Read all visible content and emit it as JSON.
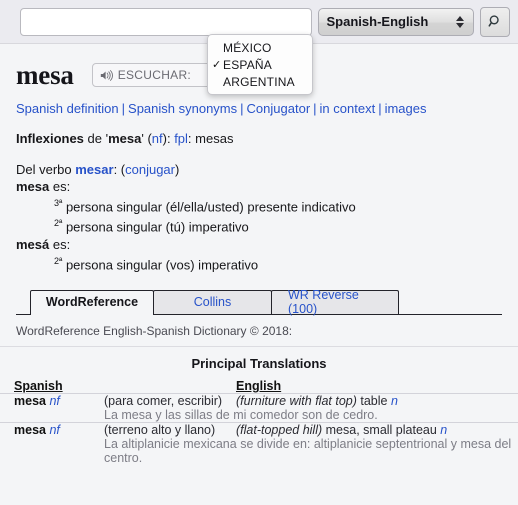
{
  "search": {
    "input_value": "",
    "input_placeholder": "",
    "dictionary_selected": "Spanish-English",
    "search_icon": "magnifier-icon"
  },
  "entry": {
    "headword": "mesa",
    "listen_label": "ESCUCHAR:",
    "speaker_icon": "speaker-icon"
  },
  "region_menu": {
    "items": [
      {
        "label": "MÉXICO",
        "checked": false,
        "check_glyph": ""
      },
      {
        "label": "ESPAÑA",
        "checked": true,
        "check_glyph": "✓"
      },
      {
        "label": "ARGENTINA",
        "checked": false,
        "check_glyph": ""
      }
    ]
  },
  "links": [
    "Spanish definition",
    "Spanish synonyms",
    "Conjugator",
    "in context",
    "images"
  ],
  "link_separator": "|",
  "inflections": {
    "label": "Inflexiones",
    "de": " de '",
    "word": "mesa",
    "close_quote": "' (",
    "gender": "nf",
    "colon": "): ",
    "plural_tag": "fpl",
    "plural_sep": ": ",
    "plural_form": "mesas"
  },
  "verb_block": {
    "intro": "Del verbo ",
    "verb": "mesar",
    "intro_tail": ": (",
    "conjugate_link": "conjugar",
    "intro_close": ")",
    "forms": [
      {
        "form": "mesa",
        "es": " es:",
        "senses": [
          "3ª persona singular (él/ella/usted) presente indicativo",
          "2ª persona singular (tú) imperativo"
        ]
      },
      {
        "form": "mesá",
        "es": " es:",
        "senses": [
          "2ª persona singular (vos) imperativo"
        ]
      }
    ]
  },
  "tabs": [
    {
      "label": "WordReference",
      "active": true
    },
    {
      "label": "Collins",
      "active": false
    },
    {
      "label": "WR Reverse (100)",
      "active": false
    }
  ],
  "dictionary": {
    "copyright": "WordReference English-Spanish Dictionary © 2018:",
    "section_title": "Principal Translations",
    "columns": {
      "spanish": "Spanish",
      "english": "English"
    },
    "rows": [
      {
        "headword": "mesa",
        "pos": "nf",
        "context_es": "(para comer, escribir)",
        "context_en": "(furniture with flat top)",
        "translation": "table",
        "translation_pos": "n",
        "example": "La mesa y las sillas de mi comedor son de cedro."
      },
      {
        "headword": "mesa",
        "pos": "nf",
        "context_es": "(terreno alto y llano)",
        "context_en": "(flat-topped hill)",
        "translation": "mesa, small plateau",
        "translation_pos": "n",
        "example": "La altiplanicie mexicana se divide en: altiplanicie septentrional y mesa del centro."
      }
    ]
  },
  "colors": {
    "link": "#2752c9",
    "topbar_bg": "#ebebf0",
    "page_bg": "#f4f5f7",
    "muted_text": "#7d7d86"
  }
}
